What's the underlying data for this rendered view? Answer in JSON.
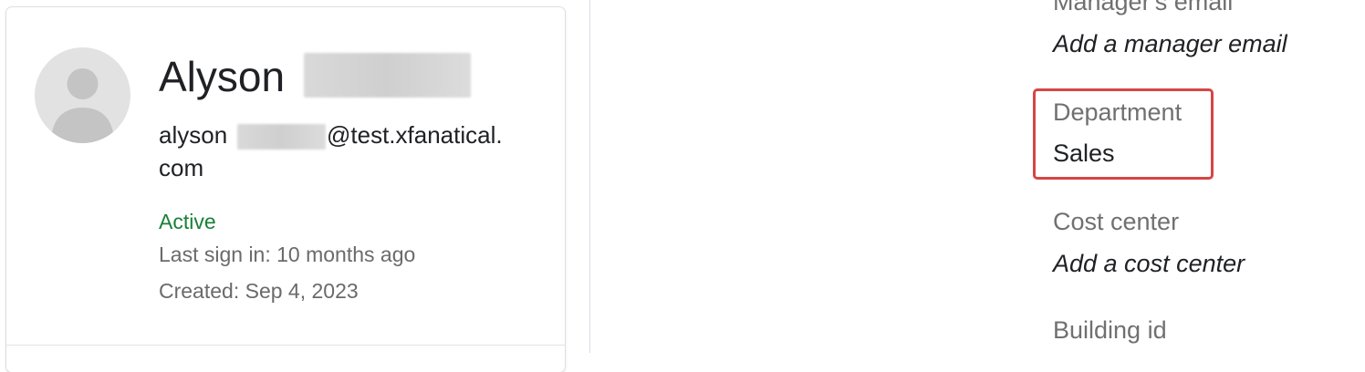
{
  "profile": {
    "first_name": "Alyson",
    "email_prefix": "alyson",
    "email_domain": "@test.xfanatical.",
    "email_domain_end": "com",
    "status": "Active",
    "last_sign_in": "Last sign in: 10 months ago",
    "created": "Created: Sep 4, 2023",
    "avatar_icon": "default-avatar-person-icon"
  },
  "details": {
    "manager_email": {
      "label": "Manager's email",
      "value": "Add a manager email"
    },
    "department": {
      "label": "Department",
      "value": "Sales"
    },
    "cost_center": {
      "label": "Cost center",
      "value": "Add a cost center"
    },
    "building_id": {
      "label": "Building id"
    }
  },
  "colors": {
    "status_active": "#188038",
    "highlight_border": "#d64545",
    "secondary_text": "#6a6a6a"
  }
}
